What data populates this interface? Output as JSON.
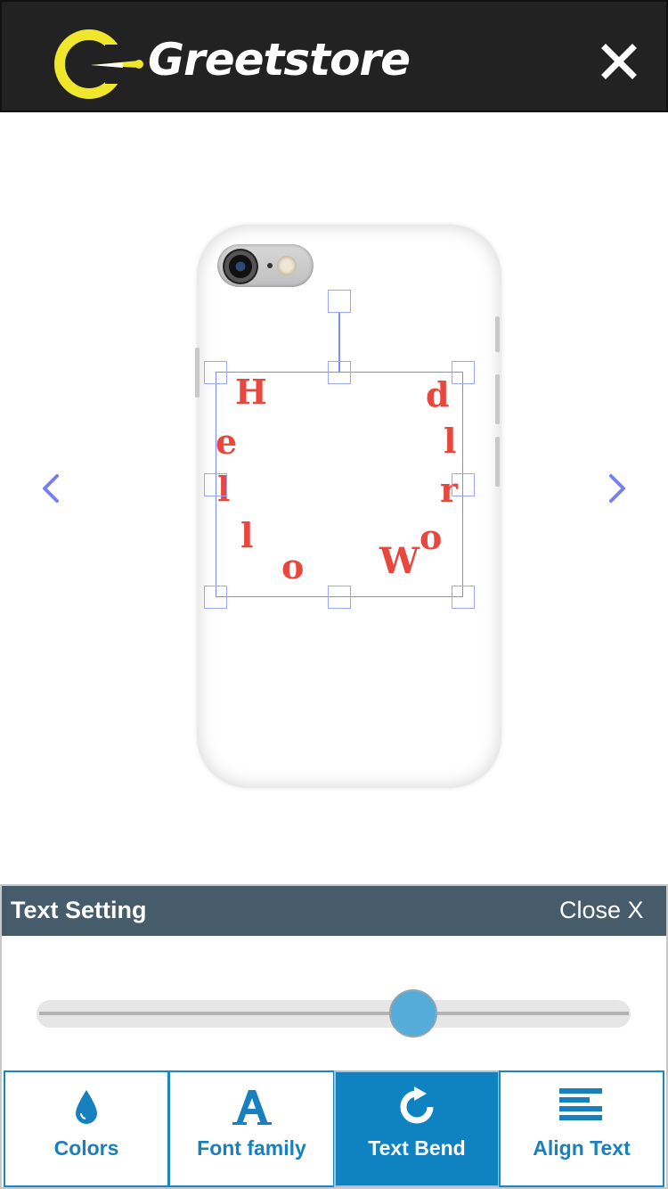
{
  "header": {
    "brand": "Greetstore",
    "logo_icon": "greetstore-logo-icon",
    "close_icon": "close-icon"
  },
  "preview": {
    "prev_icon": "chevron-left-icon",
    "next_icon": "chevron-right-icon",
    "product": "phone-case",
    "bent_text": [
      "H",
      "e",
      "l",
      "l",
      "o",
      "W",
      "o",
      "r",
      "l",
      "d"
    ],
    "text_color": "#e8473d"
  },
  "panel": {
    "title": "Text Setting",
    "close_label": "Close X",
    "bend_value": 0.63,
    "tools": [
      {
        "label": "Colors",
        "icon": "droplet-icon",
        "active": false
      },
      {
        "label": "Font family",
        "icon": "font-a-icon",
        "active": false
      },
      {
        "label": "Text Bend",
        "icon": "rotate-icon",
        "active": true
      },
      {
        "label": "Align Text",
        "icon": "align-lines-icon",
        "active": false
      }
    ]
  },
  "colors": {
    "header_bg": "#222222",
    "logo_yellow": "#f0e62c",
    "panel_head": "#465c6b",
    "accent_blue": "#1780bf",
    "slider_thumb": "#56acd9",
    "selection": "#7b8cff"
  }
}
